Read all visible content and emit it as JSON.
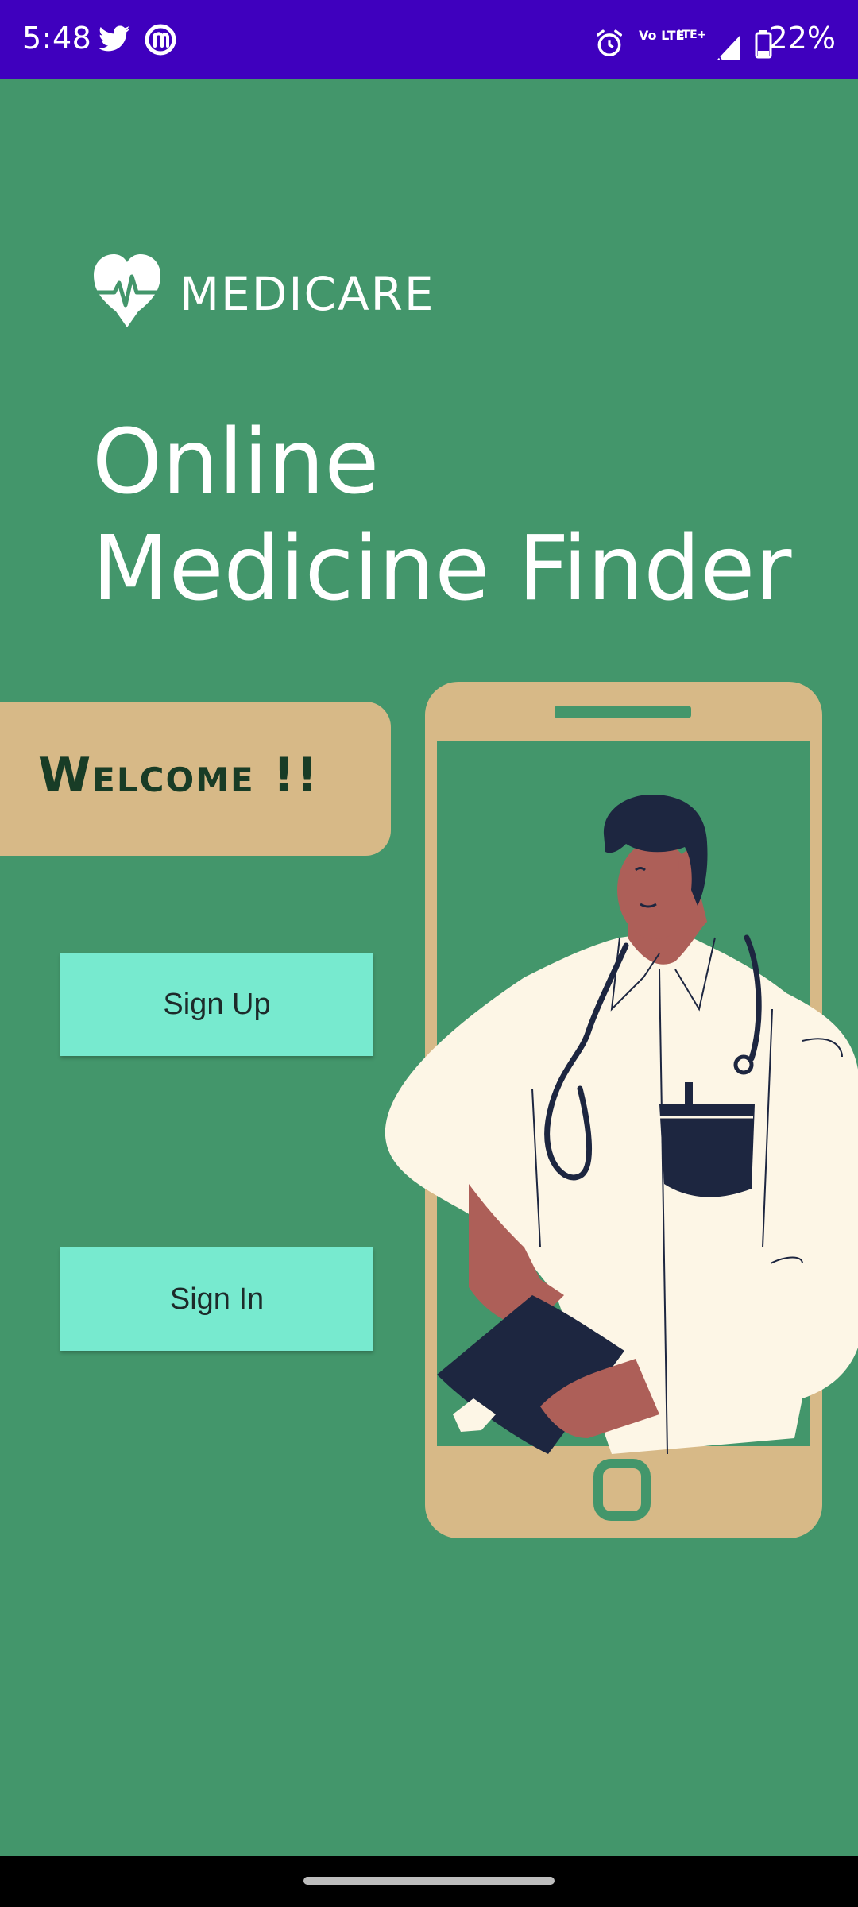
{
  "status_bar": {
    "time": "5:48",
    "battery": "22%",
    "left_icons": [
      "twitter-icon",
      "app-notification-icon"
    ],
    "right_icons": [
      "alarm-icon",
      "volte-icon",
      "lte-signal-icon",
      "battery-icon"
    ],
    "volte_label": "Vo LTE",
    "lte_label": "LTE+"
  },
  "app": {
    "logo_text": "MEDICARE",
    "headline_line1": "Online",
    "headline_line2": "Medicine Finder",
    "welcome_text": "Welcome !!",
    "signup_label": "Sign Up",
    "signin_label": "Sign In"
  },
  "colors": {
    "background": "#43966b",
    "status_bar": "#3f00be",
    "button": "#77eacf",
    "card": "#d7b987",
    "phone_frame": "#d7b987"
  }
}
